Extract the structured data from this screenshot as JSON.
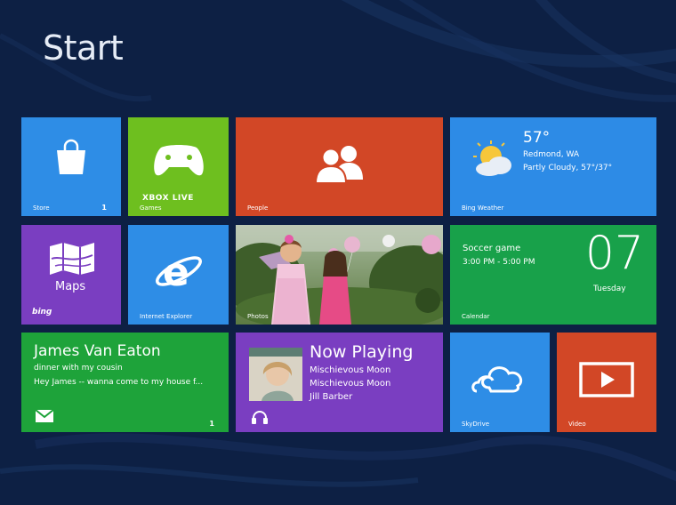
{
  "header": {
    "title": "Start"
  },
  "tiles": {
    "store": {
      "label": "Store",
      "badge": "1",
      "color": "#2e8de6",
      "icon": "shopping-bag-icon"
    },
    "games": {
      "label": "Games",
      "brand": "XBOX LIVE",
      "color": "#6ebf1f",
      "icon": "xbox-controller-icon"
    },
    "people": {
      "label": "People",
      "color": "#d24726",
      "icon": "people-icon"
    },
    "weather": {
      "label": "Bing Weather",
      "temperature": "57°",
      "location": "Redmond, WA",
      "condition": "Partly Cloudy, 57°/37°",
      "color": "#2d8be6",
      "icon": "sun-cloud-icon"
    },
    "maps": {
      "title": "Maps",
      "brand": "bing",
      "color": "#7a3ec1",
      "icon": "folded-map-icon"
    },
    "ie": {
      "label": "Internet Explorer",
      "color": "#2e8de6",
      "icon": "internet-explorer-icon"
    },
    "photos": {
      "label": "Photos"
    },
    "calendar": {
      "label": "Calendar",
      "event": "Soccer game",
      "time": "3:00 PM - 5:00 PM",
      "date": "07",
      "day": "Tuesday",
      "color": "#18a14a"
    },
    "mail": {
      "sender": "James Van Eaton",
      "subject": "dinner with my cousin",
      "preview": "Hey James -- wanna come to my house f...",
      "badge": "1",
      "color": "#1ea33a",
      "icon": "envelope-icon"
    },
    "music": {
      "heading": "Now Playing",
      "lines": [
        "Mischievous Moon",
        "Mischievous Moon",
        "Jill Barber"
      ],
      "color": "#7a3ec1",
      "icon": "headphones-icon"
    },
    "skydrive": {
      "label": "SkyDrive",
      "color": "#2e8de6",
      "icon": "cloud-icon"
    },
    "video": {
      "label": "Video",
      "color": "#d24726",
      "icon": "play-screen-icon"
    }
  }
}
